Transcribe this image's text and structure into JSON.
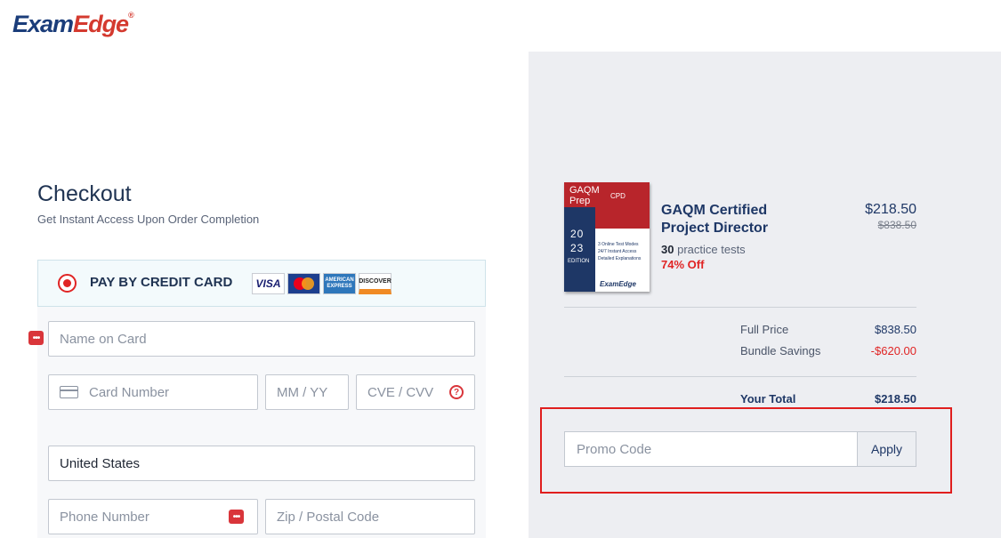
{
  "brand": {
    "part1": "Exam",
    "part2": "Edge",
    "reg": "®"
  },
  "checkout": {
    "title": "Checkout",
    "subtitle": "Get Instant Access Upon Order Completion",
    "payment": {
      "label": "PAY BY CREDIT CARD",
      "cards": [
        "VISA",
        "MasterCard",
        "AMERICAN EXPRESS",
        "DISCOVER"
      ]
    },
    "fields": {
      "name_placeholder": "Name on Card",
      "card_placeholder": "Card Number",
      "expiry_placeholder": "MM / YY",
      "cvv_placeholder": "CVE / CVV",
      "country_value": "United States",
      "phone_placeholder": "Phone Number",
      "zip_placeholder": "Zip / Postal Code"
    },
    "icons": {
      "badge": "•••",
      "help": "?"
    }
  },
  "product": {
    "cover": {
      "top": "GAQM\nPrep",
      "tag": "CPD",
      "year": "20\n23",
      "edition": "EDITION",
      "features": [
        "3 Online Test Modes",
        "24/7 Instant Access",
        "Detailed Explanations"
      ],
      "brand": "ExamEdge"
    },
    "title": "GAQM Certified Project Director",
    "count": "30",
    "count_label": "practice tests",
    "discount": "74% Off",
    "price": "$218.50",
    "old_price": "$838.50"
  },
  "summary": {
    "full_price_label": "Full Price",
    "full_price_value": "$838.50",
    "savings_label": "Bundle Savings",
    "savings_value": "-$620.00",
    "total_label": "Your Total",
    "total_value": "$218.50"
  },
  "promo": {
    "placeholder": "Promo Code",
    "apply_label": "Apply"
  },
  "colors": {
    "accent": "#e02424",
    "navy": "#1e3766",
    "panel": "#edeef2"
  }
}
